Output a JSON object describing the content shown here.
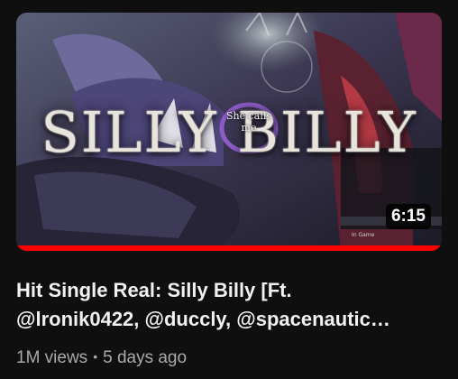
{
  "video": {
    "thumbnail": {
      "title_art": "SILLY BILLY",
      "overlay_text": "She calls me",
      "mini_label": "In Game",
      "duration": "6:15",
      "watched_fraction": 1.0
    },
    "title_line1": "Hit Single Real: Silly Billy [Ft.",
    "title_line2": "@lronik0422, @duccly, @spacenautic…",
    "views": "1M views",
    "separator": "•",
    "age": "5 days ago"
  },
  "colors": {
    "background": "#0f0f0f",
    "progress": "#ff0000",
    "title_text": "#f1f1f1",
    "meta_text": "#aaaaaa"
  }
}
